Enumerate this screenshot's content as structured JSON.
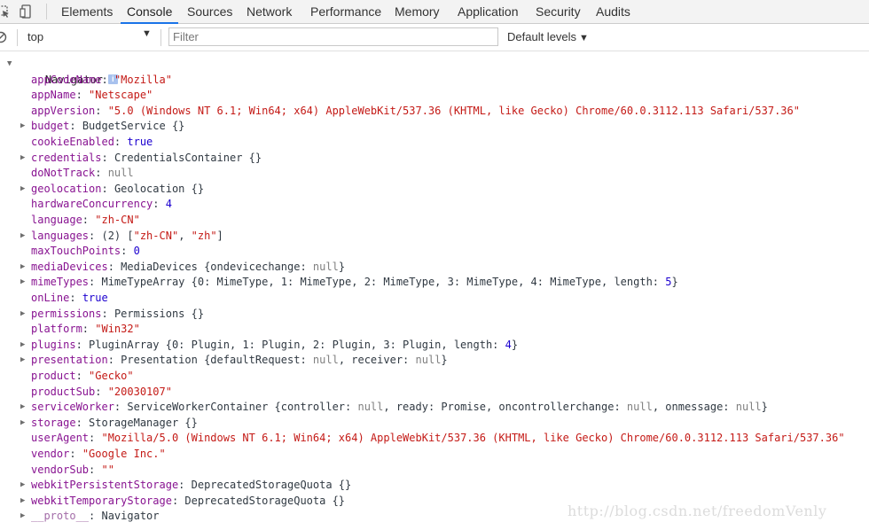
{
  "toolbar": {
    "tabs": [
      "Elements",
      "Console",
      "Sources",
      "Network",
      "Performance",
      "Memory",
      "Application",
      "Security",
      "Audits"
    ],
    "active_tab": "Console"
  },
  "filterbar": {
    "context": "top",
    "filter_placeholder": "Filter",
    "levels": "Default levels"
  },
  "console": {
    "object_name": "Navigator",
    "properties": [
      {
        "key": "appCodeName",
        "type": "string",
        "value": "\"Mozilla\""
      },
      {
        "key": "appName",
        "type": "string",
        "value": "\"Netscape\""
      },
      {
        "key": "appVersion",
        "type": "string",
        "value": "\"5.0 (Windows NT 6.1; Win64; x64) AppleWebKit/537.36 (KHTML, like Gecko) Chrome/60.0.3112.113 Safari/537.36\""
      },
      {
        "key": "budget",
        "type": "object",
        "expandable": true,
        "value": "BudgetService {}"
      },
      {
        "key": "cookieEnabled",
        "type": "number",
        "value": "true"
      },
      {
        "key": "credentials",
        "type": "object",
        "expandable": true,
        "value": "CredentialsContainer {}"
      },
      {
        "key": "doNotTrack",
        "type": "null",
        "value": "null"
      },
      {
        "key": "geolocation",
        "type": "object",
        "expandable": true,
        "value": "Geolocation {}"
      },
      {
        "key": "hardwareConcurrency",
        "type": "number",
        "value": "4"
      },
      {
        "key": "language",
        "type": "string",
        "value": "\"zh-CN\""
      },
      {
        "key": "languages",
        "type": "array",
        "expandable": true,
        "prefix": "(2) [",
        "items": [
          "\"zh-CN\"",
          "\"zh\""
        ],
        "suffix": "]"
      },
      {
        "key": "maxTouchPoints",
        "type": "number",
        "value": "0"
      },
      {
        "key": "mediaDevices",
        "type": "object",
        "expandable": true,
        "value": "MediaDevices {ondevicechange: null}"
      },
      {
        "key": "mimeTypes",
        "type": "object",
        "expandable": true,
        "value": "MimeTypeArray {0: MimeType, 1: MimeType, 2: MimeType, 3: MimeType, 4: MimeType, length: 5}"
      },
      {
        "key": "onLine",
        "type": "number",
        "value": "true"
      },
      {
        "key": "permissions",
        "type": "object",
        "expandable": true,
        "value": "Permissions {}"
      },
      {
        "key": "platform",
        "type": "string",
        "value": "\"Win32\""
      },
      {
        "key": "plugins",
        "type": "object",
        "expandable": true,
        "value": "PluginArray {0: Plugin, 1: Plugin, 2: Plugin, 3: Plugin, length: 4}"
      },
      {
        "key": "presentation",
        "type": "object",
        "expandable": true,
        "value": "Presentation {defaultRequest: null, receiver: null}"
      },
      {
        "key": "product",
        "type": "string",
        "value": "\"Gecko\""
      },
      {
        "key": "productSub",
        "type": "string",
        "value": "\"20030107\""
      },
      {
        "key": "serviceWorker",
        "type": "object",
        "expandable": true,
        "value": "ServiceWorkerContainer {controller: null, ready: Promise, oncontrollerchange: null, onmessage: null}"
      },
      {
        "key": "storage",
        "type": "object",
        "expandable": true,
        "value": "StorageManager {}"
      },
      {
        "key": "userAgent",
        "type": "string",
        "value": "\"Mozilla/5.0 (Windows NT 6.1; Win64; x64) AppleWebKit/537.36 (KHTML, like Gecko) Chrome/60.0.3112.113 Safari/537.36\""
      },
      {
        "key": "vendor",
        "type": "string",
        "value": "\"Google Inc.\""
      },
      {
        "key": "vendorSub",
        "type": "string",
        "value": "\"\""
      },
      {
        "key": "webkitPersistentStorage",
        "type": "object",
        "expandable": true,
        "value": "DeprecatedStorageQuota {}"
      },
      {
        "key": "webkitTemporaryStorage",
        "type": "object",
        "expandable": true,
        "value": "DeprecatedStorageQuota {}"
      },
      {
        "key": "__proto__",
        "type": "object",
        "expandable": true,
        "dim": true,
        "value": "Navigator"
      }
    ]
  },
  "watermark": "http://blog.csdn.net/freedomVenly",
  "colors": {
    "key": "#881391",
    "string": "#c41a16",
    "number": "#1c00cf",
    "null": "#808080",
    "active_tab_underline": "#1a73e8"
  }
}
